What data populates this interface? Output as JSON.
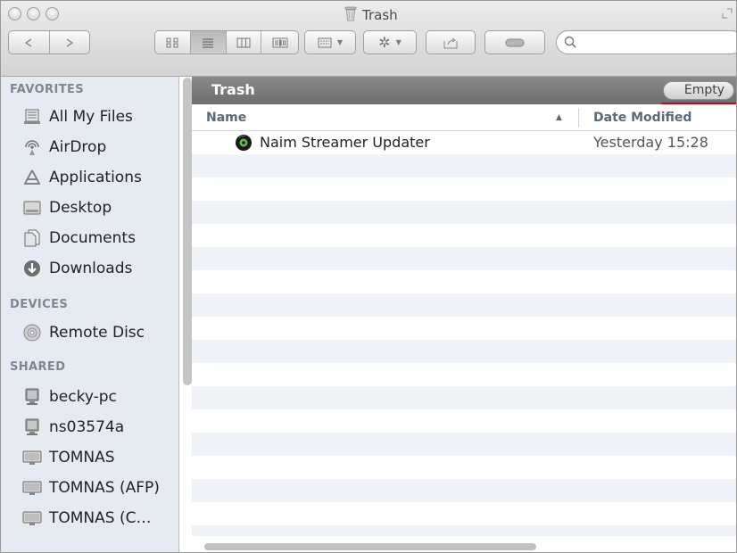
{
  "window": {
    "title": "Trash"
  },
  "sidebar": {
    "favorites_label": "FAVORITES",
    "favorites": [
      {
        "label": "All My Files",
        "icon": "all-files-icon"
      },
      {
        "label": "AirDrop",
        "icon": "airdrop-icon"
      },
      {
        "label": "Applications",
        "icon": "applications-icon"
      },
      {
        "label": "Desktop",
        "icon": "desktop-icon"
      },
      {
        "label": "Documents",
        "icon": "documents-icon"
      },
      {
        "label": "Downloads",
        "icon": "downloads-icon"
      }
    ],
    "devices_label": "DEVICES",
    "devices": [
      {
        "label": "Remote Disc",
        "icon": "disc-icon"
      }
    ],
    "shared_label": "SHARED",
    "shared": [
      {
        "label": "becky-pc",
        "icon": "pc-icon"
      },
      {
        "label": "ns03574a",
        "icon": "pc-icon"
      },
      {
        "label": "TOMNAS",
        "icon": "server-icon"
      },
      {
        "label": "TOMNAS (AFP)",
        "icon": "server-icon"
      },
      {
        "label": "TOMNAS (C…",
        "icon": "server-icon"
      }
    ]
  },
  "main": {
    "path_title": "Trash",
    "empty_button": "Empty",
    "columns": {
      "name": "Name",
      "date": "Date Modified"
    },
    "files": [
      {
        "name": "Naim Streamer Updater",
        "date": "Yesterday 15:28",
        "icon": "app-disc-icon"
      }
    ]
  },
  "colors": {
    "highlight": "#d0021b",
    "sidebar_bg": "#e6ebf1",
    "path_bar": "#7a7a7a"
  }
}
